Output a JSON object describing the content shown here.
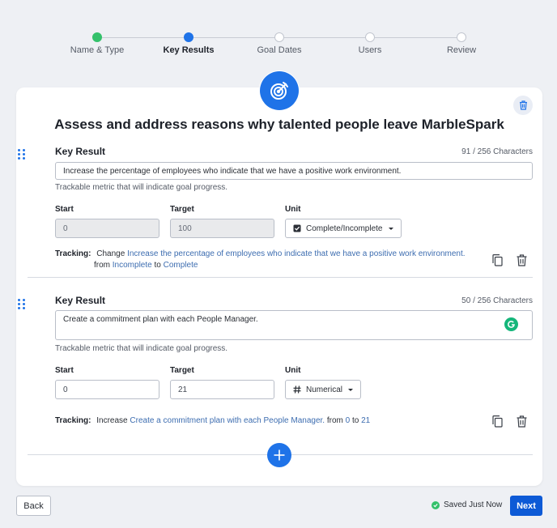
{
  "stepper": {
    "steps": [
      {
        "label": "Name & Type",
        "state": "done"
      },
      {
        "label": "Key Results",
        "state": "active"
      },
      {
        "label": "Goal Dates",
        "state": "pending"
      },
      {
        "label": "Users",
        "state": "pending"
      },
      {
        "label": "Review",
        "state": "pending"
      }
    ]
  },
  "goal": {
    "title": "Assess and address reasons why talented people leave MarbleSpark",
    "icon": "target-arrow-icon"
  },
  "key_results": [
    {
      "heading": "Key Result",
      "char_count": "91 / 256 Characters",
      "text": "Increase the percentage of employees who indicate that we have a positive work environment.",
      "help": "Trackable metric that will indicate goal progress.",
      "start_label": "Start",
      "start_value": "0",
      "target_label": "Target",
      "target_value": "100",
      "unit_label": "Unit",
      "unit_value": "Complete/Incomplete",
      "unit_icon": "checkbox-icon",
      "tracking_label": "Tracking:",
      "tracking": {
        "verb": "Change",
        "metric": "Increase the percentage of employees who indicate that we have a positive work environment.",
        "from_word": "from",
        "from_value": "Incomplete",
        "to_word": "to",
        "to_value": "Complete"
      }
    },
    {
      "heading": "Key Result",
      "char_count": "50 / 256 Characters",
      "text": "Create a commitment plan with each People Manager.",
      "help": "Trackable metric that will indicate goal progress.",
      "start_label": "Start",
      "start_value": "0",
      "target_label": "Target",
      "target_value": "21",
      "unit_label": "Unit",
      "unit_value": "Numerical",
      "unit_icon": "hash-icon",
      "tracking_label": "Tracking:",
      "tracking": {
        "verb": "Increase",
        "metric": "Create a commitment plan with each People Manager.",
        "from_word": "from",
        "from_value": "0",
        "to_word": "to",
        "to_value": "21"
      }
    }
  ],
  "footer": {
    "back_label": "Back",
    "saved_label": "Saved Just Now",
    "next_label": "Next"
  },
  "colors": {
    "accent": "#1f73e8",
    "success": "#34c16b",
    "primary_button": "#0d5ad6",
    "background": "#eef0f4"
  }
}
